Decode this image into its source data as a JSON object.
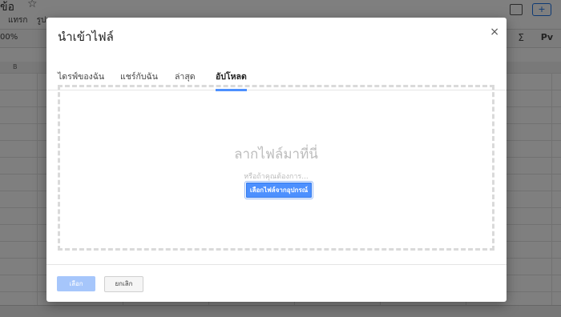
{
  "background": {
    "doc_title": "ข้อ",
    "star": "☆",
    "menu": [
      "แทรก",
      "รูปแ",
      "..."
    ],
    "zoom": "00%",
    "sigma": "Σ",
    "lang": "Pv",
    "col_b": "B"
  },
  "dialog": {
    "title": "นำเข้าไฟล์",
    "close": "×",
    "tabs": [
      {
        "label": "ไดรฟ์ของฉัน"
      },
      {
        "label": "แชร์กับฉัน"
      },
      {
        "label": "ล่าสุด"
      },
      {
        "label": "อัปโหลด"
      }
    ],
    "dropzone": {
      "title": "ลากไฟล์มาที่นี่",
      "subtitle": "หรือถ้าคุณต้องการ...",
      "button": "เลือกไฟล์จากอุปกรณ์"
    },
    "footer": {
      "select": "เลือก",
      "cancel": "ยกเลิก"
    }
  }
}
